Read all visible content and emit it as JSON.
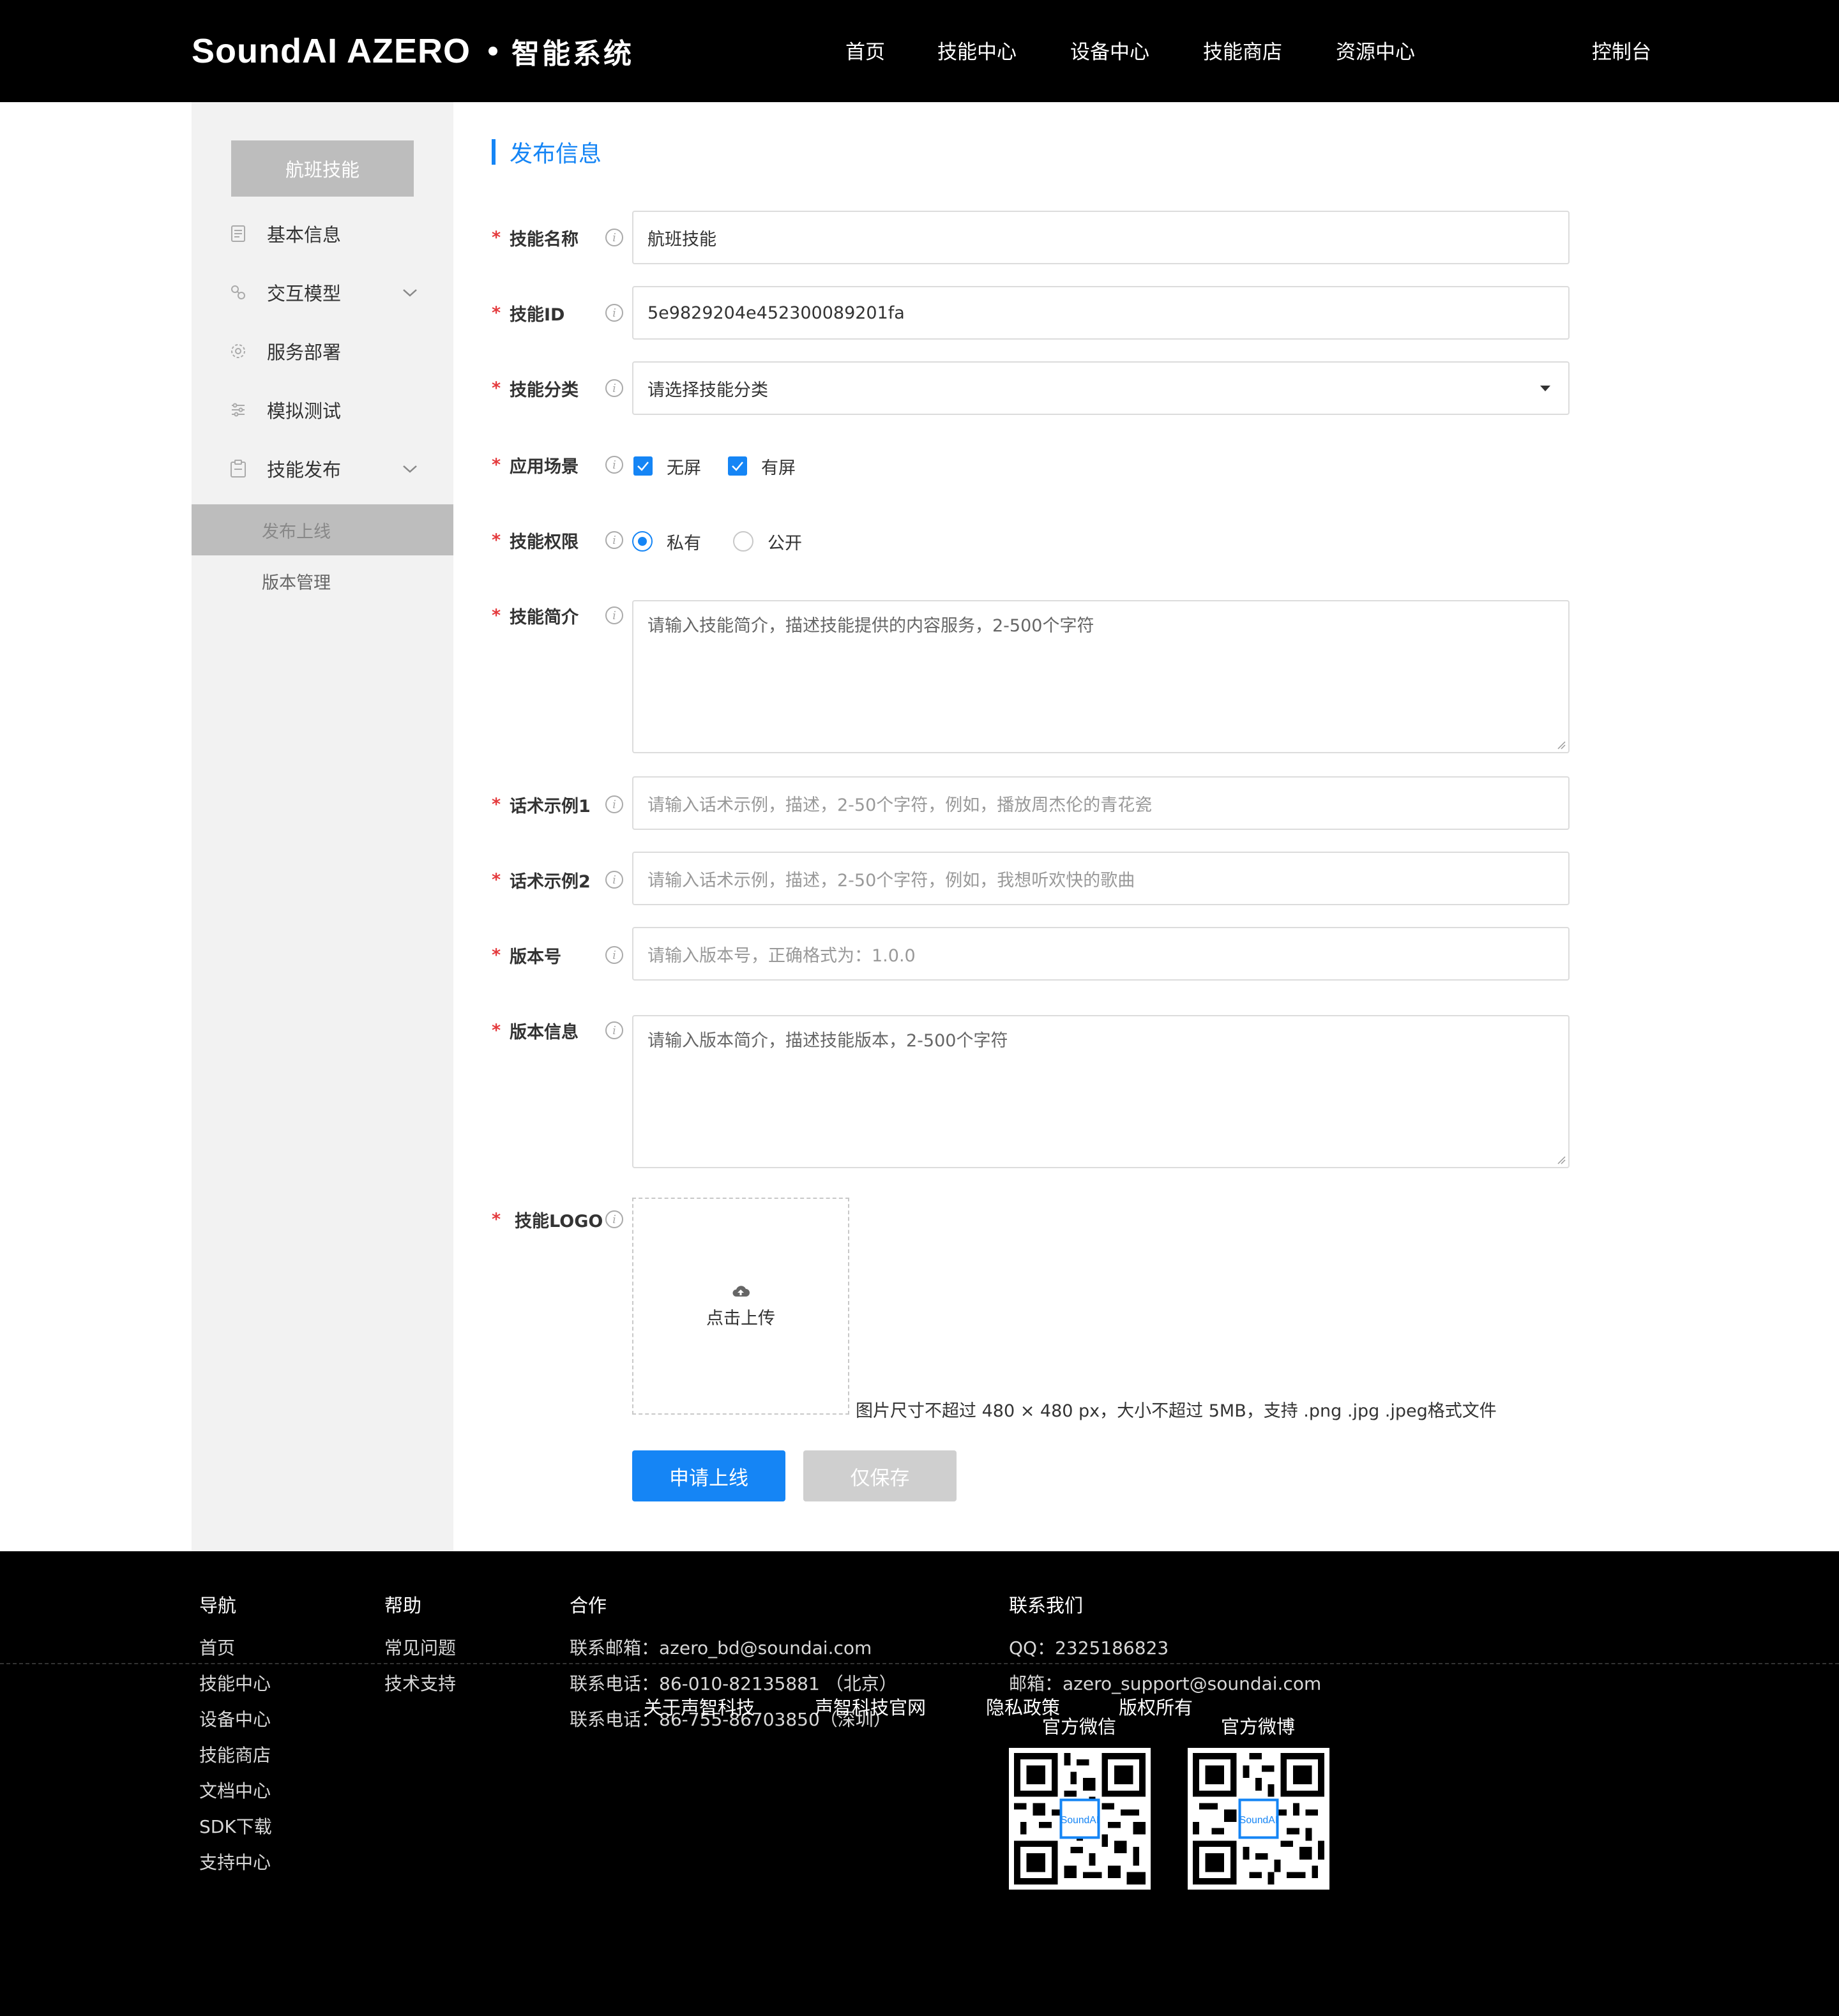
{
  "header": {
    "brand": "SoundAI AZERO",
    "system": "智能系统",
    "nav": [
      "首页",
      "技能中心",
      "设备中心",
      "技能商店",
      "资源中心"
    ],
    "console": "控制台"
  },
  "sidebar": {
    "skill_name": "航班技能",
    "items": [
      {
        "label": "基本信息",
        "icon": "document-icon"
      },
      {
        "label": "交互模型",
        "icon": "model-icon"
      },
      {
        "label": "服务部署",
        "icon": "gear-icon"
      },
      {
        "label": "模拟测试",
        "icon": "sliders-icon"
      },
      {
        "label": "技能发布",
        "icon": "clipboard-icon"
      }
    ],
    "sub_items": [
      "发布上线",
      "版本管理"
    ]
  },
  "form": {
    "title": "发布信息",
    "fields": {
      "name": {
        "label": "技能名称",
        "value": "航班技能"
      },
      "id": {
        "label": "技能ID",
        "value": "5e9829204e452300089201fa"
      },
      "category": {
        "label": "技能分类",
        "value": "请选择技能分类"
      },
      "scene": {
        "label": "应用场景",
        "options": [
          "无屏",
          "有屏"
        ]
      },
      "permission": {
        "label": "技能权限",
        "options": [
          "私有",
          "公开"
        ],
        "selected": "私有"
      },
      "intro": {
        "label": "技能简介",
        "placeholder": "请输入技能简介，描述技能提供的内容服务，2-500个字符"
      },
      "example1": {
        "label": "话术示例1",
        "placeholder": "请输入话术示例，描述，2-50个字符，例如，播放周杰伦的青花瓷"
      },
      "example2": {
        "label": "话术示例2",
        "placeholder": "请输入话术示例，描述，2-50个字符，例如，我想听欢快的歌曲"
      },
      "version": {
        "label": "版本号",
        "placeholder": "请输入版本号，正确格式为：1.0.0"
      },
      "version_info": {
        "label": "版本信息",
        "placeholder": "请输入版本简介，描述技能版本，2-500个字符"
      },
      "logo": {
        "label": "技能LOGO",
        "upload_text": "点击上传",
        "hint": "图片尺寸不超过 480 × 480 px，大小不超过 5MB，支持 .png .jpg .jpeg格式文件"
      }
    },
    "buttons": {
      "submit": "申请上线",
      "save": "仅保存"
    }
  },
  "footer": {
    "nav": {
      "title": "导航",
      "items": [
        "首页",
        "技能中心",
        "设备中心",
        "技能商店",
        "文档中心",
        "SDK下载",
        "支持中心"
      ]
    },
    "help": {
      "title": "帮助",
      "items": [
        "常见问题",
        "技术支持"
      ]
    },
    "coop": {
      "title": "合作",
      "items": [
        "联系邮箱：azero_bd@soundai.com",
        "联系电话：86-010-82135881 （北京）",
        "联系电话：86-755-86703850（深圳）"
      ]
    },
    "contact": {
      "title": "联系我们",
      "items": [
        "QQ：2325186823",
        "邮箱：azero_support@soundai.com"
      ]
    },
    "qr": {
      "wechat": "官方微信",
      "weibo": "官方微博"
    },
    "links": [
      "关于声智科技",
      "声智科技官网",
      "隐私政策",
      "版权所有"
    ]
  },
  "colors": {
    "accent": "#1585f5",
    "required": "#e4393c",
    "header_bg": "#000000",
    "sidebar_bg": "#f2f2f2"
  }
}
